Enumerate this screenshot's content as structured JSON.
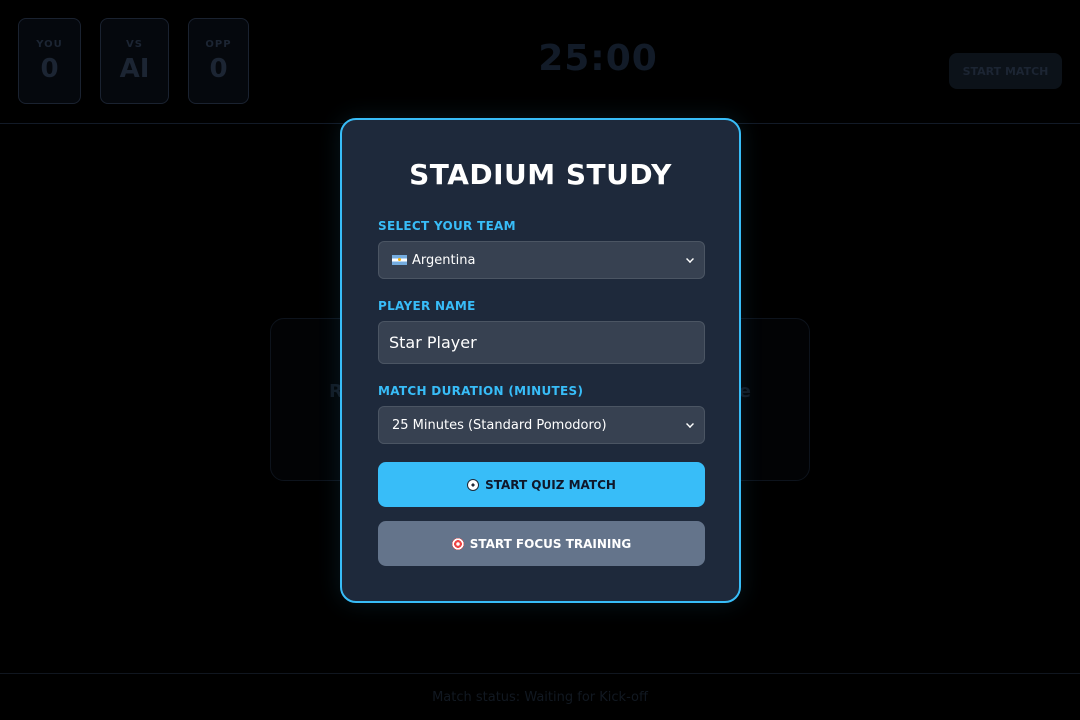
{
  "header": {
    "you": {
      "label": "YOU",
      "score": "0"
    },
    "vs": {
      "label": "VS",
      "value": "AI"
    },
    "opp": {
      "label": "OPP",
      "score": "0"
    },
    "timer": "25:00",
    "start_match_label": "START MATCH"
  },
  "background_card": {
    "left_fragment": "R",
    "right_fragment": "e"
  },
  "footer": {
    "status": "Match status: Waiting for Kick-off"
  },
  "modal": {
    "title": "STADIUM STUDY",
    "team": {
      "label": "SELECT YOUR TEAM",
      "selected": "Argentina",
      "flag_icon": "argentina-flag-icon"
    },
    "player": {
      "label": "PLAYER NAME",
      "value": "Star Player"
    },
    "duration": {
      "label": "MATCH DURATION (MINUTES)",
      "selected": "25 Minutes (Standard Pomodoro)"
    },
    "quiz_button": {
      "label": "START QUIZ MATCH",
      "icon": "soccer-ball-icon"
    },
    "focus_button": {
      "label": "START FOCUS TRAINING",
      "icon": "target-icon"
    }
  },
  "colors": {
    "accent": "#38bdf8",
    "modal_bg": "#1e293b",
    "input_bg": "#374151",
    "secondary_button": "#64748b"
  }
}
